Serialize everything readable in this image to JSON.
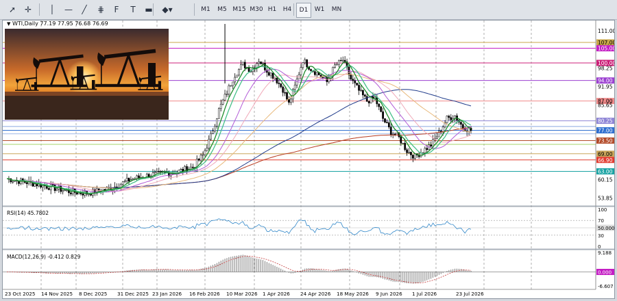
{
  "toolbar": {
    "tools": [
      {
        "name": "cursor-tool",
        "glyph": "➚"
      },
      {
        "name": "crosshair-tool",
        "glyph": "✛"
      },
      {
        "name": "vertical-line-tool",
        "glyph": "│"
      },
      {
        "name": "horizontal-line-tool",
        "glyph": "—"
      },
      {
        "name": "trendline-tool",
        "glyph": "╱"
      },
      {
        "name": "channel-tool",
        "glyph": "⋕"
      },
      {
        "name": "fibonacci-tool",
        "glyph": "F"
      },
      {
        "name": "text-tool",
        "glyph": "T"
      },
      {
        "name": "rectangle-tool",
        "glyph": "▬"
      },
      {
        "name": "shapes-tool",
        "glyph": "◆▾"
      }
    ],
    "timeframes": [
      "M1",
      "M5",
      "M15",
      "M30",
      "H1",
      "H4",
      "D1",
      "W1",
      "MN"
    ],
    "active_timeframe": "D1"
  },
  "chart": {
    "title": "WTI,Daily  77.19 77.95 76.68 76.69",
    "price_labels": [
      {
        "text": "111.00",
        "value": 111.0,
        "kind": "plain"
      },
      {
        "text": "107.00",
        "value": 107.0,
        "kind": "badge",
        "bg": "#c8a64a",
        "fg": "#000000"
      },
      {
        "text": "105.00",
        "value": 105.0,
        "kind": "badge",
        "bg": "#c41ec4",
        "fg": "#ffffff"
      },
      {
        "text": "100.00",
        "value": 100.0,
        "kind": "badge",
        "bg": "#cc1f78",
        "fg": "#ffffff"
      },
      {
        "text": "98.25",
        "value": 98.25,
        "kind": "plain"
      },
      {
        "text": "94.00",
        "value": 94.0,
        "kind": "badge",
        "bg": "#9b3fd1",
        "fg": "#ffffff"
      },
      {
        "text": "91.95",
        "value": 91.95,
        "kind": "plain"
      },
      {
        "text": "87.00",
        "value": 87.0,
        "kind": "badge",
        "bg": "#f08a8a",
        "fg": "#000000"
      },
      {
        "text": "85.65",
        "value": 85.65,
        "kind": "plain"
      },
      {
        "text": "80.25",
        "value": 80.25,
        "kind": "badge",
        "bg": "#8e85d6",
        "fg": "#ffffff"
      },
      {
        "text": "77.00",
        "value": 77.0,
        "kind": "badge",
        "bg": "#2f6fd0",
        "fg": "#ffffff"
      },
      {
        "text": "73.50",
        "value": 73.5,
        "kind": "badge",
        "bg": "#b34b2a",
        "fg": "#ffffff"
      },
      {
        "text": "69.00",
        "value": 69.0,
        "kind": "badge",
        "bg": "#c9a55a",
        "fg": "#000000"
      },
      {
        "text": "66.90",
        "value": 66.9,
        "kind": "badge",
        "bg": "#e23a2e",
        "fg": "#ffffff"
      },
      {
        "text": "63.00",
        "value": 63.0,
        "kind": "badge",
        "bg": "#19a3a3",
        "fg": "#ffffff"
      },
      {
        "text": "60.15",
        "value": 60.15,
        "kind": "plain"
      },
      {
        "text": "53.85",
        "value": 53.85,
        "kind": "plain"
      }
    ],
    "levels": [
      {
        "value": 107.0,
        "color": "#c8a64a"
      },
      {
        "value": 105.0,
        "color": "#c41ec4"
      },
      {
        "value": 100.0,
        "color": "#cc1f78"
      },
      {
        "value": 94.0,
        "color": "#9b3fd1"
      },
      {
        "value": 87.0,
        "color": "#f08a8a"
      },
      {
        "value": 80.25,
        "color": "#8e85d6"
      },
      {
        "value": 78.3,
        "color": "#8aa7e0"
      },
      {
        "value": 77.0,
        "color": "#2f6fd0"
      },
      {
        "value": 75.8,
        "color": "#9fb9e8"
      },
      {
        "value": 73.5,
        "color": "#b34b2a"
      },
      {
        "value": 72.2,
        "color": "#a6d36a"
      },
      {
        "value": 69.0,
        "color": "#c9a55a"
      },
      {
        "value": 66.9,
        "color": "#e23a2e"
      },
      {
        "value": 63.0,
        "color": "#19a3a3"
      }
    ],
    "date_labels": [
      "23 Oct 2025",
      "14 Nov 2025",
      "8 Dec 2025",
      "31 Dec 2025",
      "23 Jan 2026",
      "16 Feb 2026",
      "10 Mar 2026",
      "1 Apr 2026",
      "24 Apr 2026",
      "18 May 2026",
      "9 Jun 2026",
      "1 Jul 2026",
      "23 Jul 2026"
    ],
    "ma_colors": {
      "ma_fast": "#1e8a2a",
      "ma_teal": "#46c08a",
      "ma_purple": "#b25ad6",
      "ma_pink": "#f0a8b8",
      "ma_tan": "#e8b87a",
      "ma_navy": "#1f3a8a",
      "ma_red": "#b83a1e"
    }
  },
  "rsi": {
    "title": "RSI(14) 45.7802",
    "labels": [
      "100",
      "70",
      "50.0000",
      "30",
      "0"
    ],
    "current": 45.78
  },
  "macd": {
    "title": "MACD(12,26,9) -0.412 0.829",
    "labels": [
      "9.188",
      "0.000",
      "-6.607"
    ],
    "current": -0.412,
    "signal": 0.829
  }
}
